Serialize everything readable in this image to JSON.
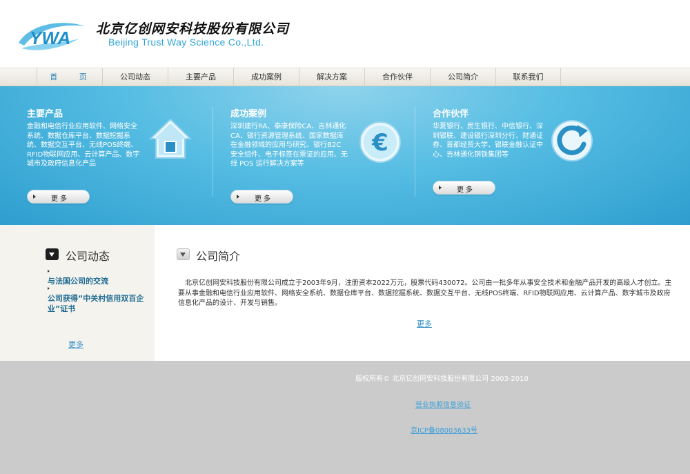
{
  "brand": {
    "logo_text": "YWA",
    "name_cn": "北京亿创网安科技股份有限公司",
    "name_en": "Beijing Trust Way Science Co.,Ltd."
  },
  "nav": {
    "items": [
      "首 页",
      "公司动态",
      "主要产品",
      "成功案例",
      "解决方案",
      "合作伙伴",
      "公司简介",
      "联系我们"
    ]
  },
  "banner": {
    "blocks": [
      {
        "title": "主要产品",
        "text": "金融和电信行业应用软件、网络安全系统、数据仓库平台、数据挖掘系统、数据交互平台、无线POS终端、RFID物联网应用、云计算产品、数字城市及政府信息化产品",
        "icon": "home-icon",
        "more_label": "更多"
      },
      {
        "title": "成功案例",
        "text": "深圳建行RA、泰康保险CA、吉林通化CA、银行资源管理系统、国家数据库在金融领域的应用与研究、银行B2C安全组件、电子标签在票证的应用、无线 POS 运行解决方案等",
        "icon": "euro-icon",
        "more_label": "更多"
      },
      {
        "title": "合作伙伴",
        "text": "华夏银行、民生银行、中信银行、深圳银联、建设银行深圳分行、财通证券、首都经贸大学、银联金融认证中心、吉林通化钢铁集团等",
        "icon": "refresh-icon",
        "more_label": "更多"
      }
    ]
  },
  "news": {
    "title": "公司动态",
    "items": [
      "与法国公司的交流",
      "公司获得“中关村信用双百企业”证书"
    ],
    "more_label": "更多"
  },
  "intro": {
    "title": "公司简介",
    "text": "北京亿创网安科技股份有限公司成立于2003年9月，注册资本2022万元，股票代码430072。公司由一批多年从事安全技术和金融产品开发的高级人才创立。主要从事金融和电信行业应用软件、网络安全系统、数据仓库平台、数据挖掘系统、数据交互平台、无线POS终端、RFID物联网应用、云计算产品、数字城市及政府信息化产品的设计、开发与销售。",
    "more_label": "更多"
  },
  "footer": {
    "copyright": "版权所有© 北京亿创网安科技股份有限公司 2003-2010",
    "license_link": "营业执照信息验证",
    "icp_link": "京ICP备08003633号"
  },
  "colors": {
    "accent": "#2e8fc6",
    "banner_blue": "#56bde3",
    "footer_gray": "#cbcbcb",
    "sidebar_bg": "#f4f3ee"
  }
}
